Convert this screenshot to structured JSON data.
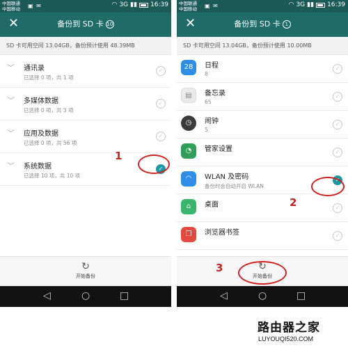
{
  "status_bar": {
    "carrier1": "中国联通",
    "carrier2": "中国移动",
    "network": "3G",
    "time": "16:39"
  },
  "left_screen": {
    "title": "备份到 SD 卡",
    "badge": "10",
    "storage": "SD 卡可用空间 13.04GB，备份预计使用 48.39MB",
    "items": [
      {
        "name": "通讯录",
        "sub": "已选择 0 项，共 1 项"
      },
      {
        "name": "多媒体数据",
        "sub": "已选择 0 项，共 3 项"
      },
      {
        "name": "应用及数据",
        "sub": "已选择 0 项，共 56 项"
      },
      {
        "name": "系统数据",
        "sub": "已选择 10 项，共 10 项"
      }
    ],
    "start_label": "开始备份"
  },
  "right_screen": {
    "title": "备份到 SD 卡",
    "badge": "1",
    "storage": "SD 卡可用空间 13.04GB，备份预计使用 10.00MB",
    "items": [
      {
        "name": "日程",
        "sub": "8",
        "icon": "calendar-icon",
        "icon_text": "28",
        "color": "#2f8ee8"
      },
      {
        "name": "备忘录",
        "sub": "65",
        "icon": "memo-icon",
        "icon_text": "",
        "color": "#e9e9e9"
      },
      {
        "name": "闹钟",
        "sub": "5",
        "icon": "clock-icon",
        "icon_text": "",
        "color": "#3b3b3b"
      },
      {
        "name": "管家设置",
        "sub": "",
        "icon": "phone-manager-icon",
        "icon_text": "",
        "color": "#2e9e58"
      },
      {
        "name": "WLAN 及密码",
        "sub": "备份时会自动开启 WLAN",
        "icon": "wifi-icon",
        "icon_text": "",
        "color": "#2f8ee8"
      },
      {
        "name": "桌面",
        "sub": "",
        "icon": "home-icon",
        "icon_text": "",
        "color": "#3bb56a"
      },
      {
        "name": "浏览器书签",
        "sub": "",
        "icon": "bookmark-icon",
        "icon_text": "",
        "color": "#e5483f"
      }
    ],
    "start_label": "开始备份"
  },
  "annotations": {
    "n1": "1",
    "n2": "2",
    "n3": "3"
  },
  "watermark": {
    "cn": "路由器之家",
    "en": "LUYOUQI520.COM"
  },
  "colors": {
    "statusbar": "#1c5a58",
    "titlebar": "#1f6b68",
    "check_on": "#1a9aa6",
    "annotation": "#d21f1b"
  }
}
